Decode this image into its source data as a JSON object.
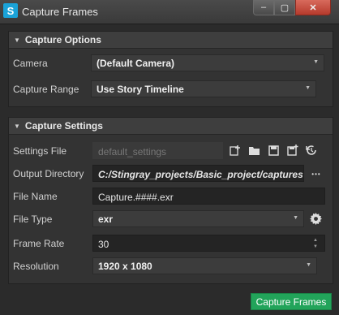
{
  "window": {
    "title": "Capture Frames",
    "app_icon": "stingray-logo-icon",
    "minimize": "–",
    "maximize": "▢",
    "close": "✕"
  },
  "capture_options": {
    "header": "Capture Options",
    "camera_label": "Camera",
    "camera_value": "(Default Camera)",
    "range_label": "Capture Range",
    "range_value": "Use Story Timeline"
  },
  "capture_settings": {
    "header": "Capture Settings",
    "settings_file_label": "Settings File",
    "settings_file_value": "default_settings",
    "settings_file_icons": [
      "add-icon",
      "folder-icon",
      "save-icon",
      "save-as-icon",
      "reset-icon"
    ],
    "output_dir_label": "Output Directory",
    "output_dir_value": "C:/Stingray_projects/Basic_project/captures",
    "browse_label": "•••",
    "file_name_label": "File Name",
    "file_name_value": "Capture.####.exr",
    "file_type_label": "File Type",
    "file_type_value": "exr",
    "frame_rate_label": "Frame Rate",
    "frame_rate_value": "30",
    "resolution_label": "Resolution",
    "resolution_value": "1920 x 1080"
  },
  "actions": {
    "capture_label": "Capture Frames"
  }
}
